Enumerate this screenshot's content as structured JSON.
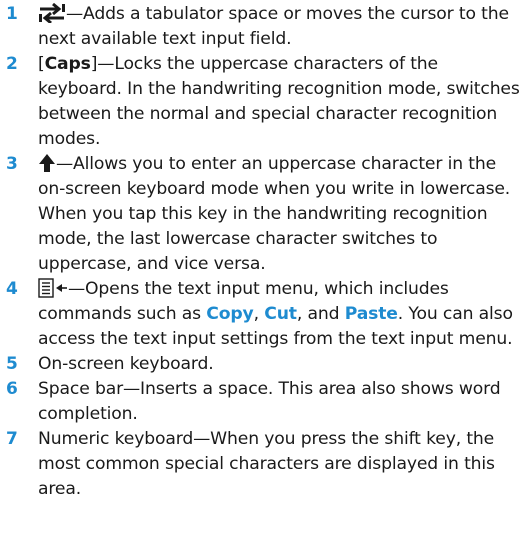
{
  "colors": {
    "accent": "#1e8bd0",
    "text": "#1a1a1a"
  },
  "items": [
    {
      "num": "1",
      "icon": "tab-arrows-icon",
      "text": "—Adds a tabulator space or moves the cursor to the next available text input field."
    },
    {
      "num": "2",
      "key": "Caps",
      "text": "—Locks the uppercase characters of the keyboard. In the handwriting recognition mode, switches between the normal and special character recognition modes."
    },
    {
      "num": "3",
      "icon": "shift-arrow-icon",
      "text": "—Allows you to enter an uppercase character in the on-screen keyboard mode when you write in lowercase. When you tap this key in the handwriting recognition mode, the last lowercase character switches to uppercase, and vice versa."
    },
    {
      "num": "4",
      "icon": "menu-list-icon",
      "text_a": "—Opens the text input menu, which includes commands such as ",
      "cmd1": "Copy",
      "sep1": ", ",
      "cmd2": "Cut",
      "sep2": ", and ",
      "cmd3": "Paste",
      "text_b": ". You can also access the text input settings from the text input menu."
    },
    {
      "num": "5",
      "text": "On-screen keyboard."
    },
    {
      "num": "6",
      "text": "Space bar—Inserts a space. This area also shows word completion."
    },
    {
      "num": "7",
      "text": "Numeric keyboard—When you press the shift key, the most common special characters are displayed in this area."
    }
  ]
}
